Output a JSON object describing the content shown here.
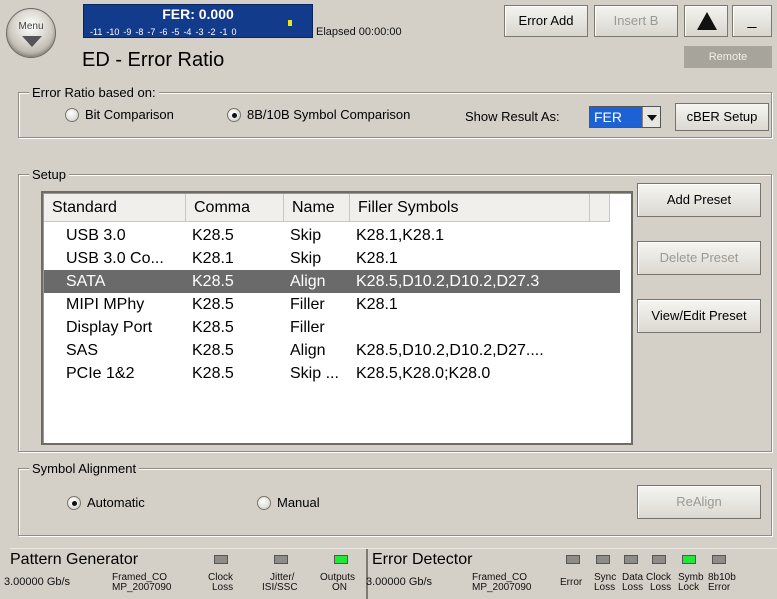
{
  "header": {
    "menu_label": "Menu",
    "fer_value": "FER: 0.000",
    "fer_scale": [
      "-11",
      "-10",
      "-9",
      "-8",
      "-7",
      "-6",
      "-5",
      "-4",
      "-3",
      "-2",
      "-1",
      "0"
    ],
    "elapsed": "Elapsed 00:00:00",
    "title": "ED - Error Ratio",
    "error_add": "Error Add",
    "insert_b": "Insert B",
    "warn_icon": "warning-icon",
    "minimize": "_",
    "remote": "Remote"
  },
  "error_ratio": {
    "group_title": "Error Ratio based on:",
    "bit_comparison": "Bit Comparison",
    "symbol_comparison": "8B/10B Symbol Comparison",
    "selected": "symbol_comparison",
    "show_result_label": "Show Result As:",
    "show_result_value": "FER",
    "cber_button": "cBER Setup"
  },
  "setup": {
    "group_title": "Setup",
    "columns": [
      "Standard",
      "Comma",
      "Name",
      "Filler Symbols"
    ],
    "rows": [
      [
        "USB 3.0",
        "K28.5",
        "Skip",
        "K28.1,K28.1"
      ],
      [
        "USB 3.0 Co...",
        "K28.1",
        "Skip",
        "K28.1"
      ],
      [
        "SATA",
        "K28.5",
        "Align",
        "K28.5,D10.2,D10.2,D27.3"
      ],
      [
        "MIPI MPhy",
        "K28.5",
        "Filler",
        "K28.1"
      ],
      [
        "Display Port",
        "K28.5",
        "Filler",
        ""
      ],
      [
        "SAS",
        "K28.5",
        "Align",
        "K28.5,D10.2,D10.2,D27...."
      ],
      [
        "PCIe 1&2",
        "K28.5",
        "Skip ...",
        "K28.5,K28.0;K28.0"
      ]
    ],
    "selected_row": 2,
    "add_preset": "Add Preset",
    "delete_preset": "Delete Preset",
    "view_edit_preset": "View/Edit Preset"
  },
  "symbol_alignment": {
    "group_title": "Symbol Alignment",
    "automatic": "Automatic",
    "manual": "Manual",
    "selected": "automatic",
    "realign": "ReAlign"
  },
  "status_bar": {
    "pg_title": "Pattern Generator",
    "pg_rate": "3.00000 Gb/s",
    "pg_pattern_1": "Framed_CO",
    "pg_pattern_2": "MP_2007090",
    "pg_leds": [
      {
        "label_1": "Clock",
        "label_2": "Loss",
        "on": false
      },
      {
        "label_1": "Jitter/",
        "label_2": "ISI/SSC",
        "on": false
      },
      {
        "label_1": "Outputs",
        "label_2": "ON",
        "on": true
      }
    ],
    "ed_title": "Error Detector",
    "ed_rate": "3.00000 Gb/s",
    "ed_pattern_1": "Framed_CO",
    "ed_pattern_2": "MP_2007090",
    "ed_leds": [
      {
        "label_1": "",
        "label_2": "Error",
        "on": false
      },
      {
        "label_1": "Sync",
        "label_2": "Loss",
        "on": false
      },
      {
        "label_1": "Data",
        "label_2": "Loss",
        "on": false
      },
      {
        "label_1": "Clock",
        "label_2": "Loss",
        "on": false
      },
      {
        "label_1": "Symb",
        "label_2": "Lock",
        "on": true
      },
      {
        "label_1": "8b10b",
        "label_2": "Error",
        "on": false
      }
    ],
    "colors": {
      "led_on": "#22e63a",
      "led_off": "#8d8c88",
      "fer_bar": "#123b8c"
    }
  }
}
